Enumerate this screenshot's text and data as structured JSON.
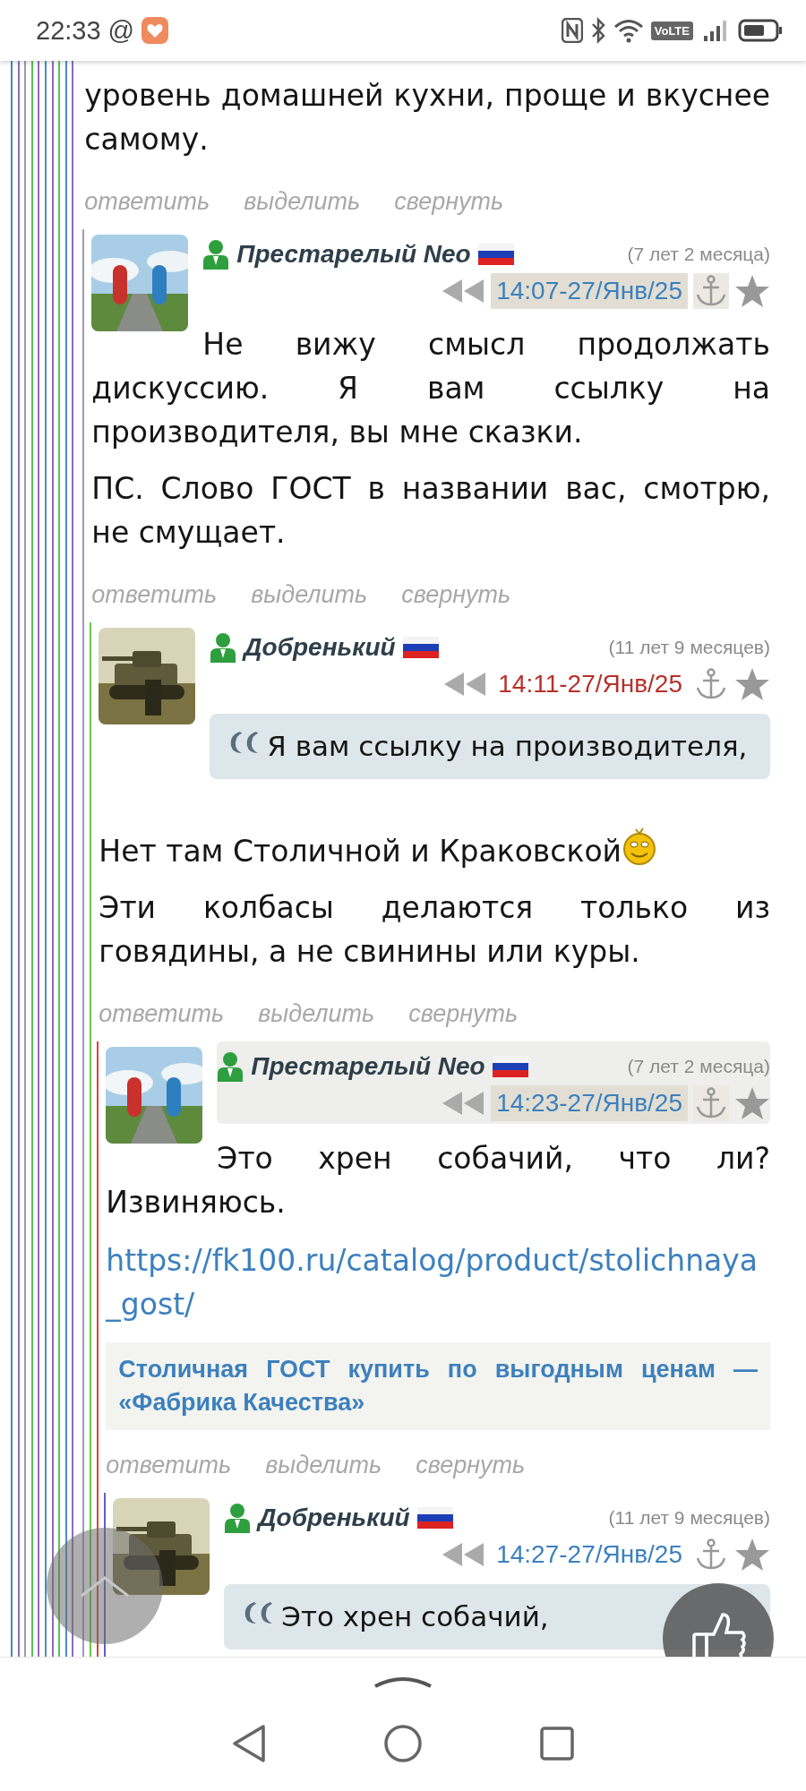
{
  "status_bar": {
    "time": "22:33",
    "at": "@",
    "volte": "VoLTE"
  },
  "thread_lines": [
    {
      "color": "#3a8fb7"
    },
    {
      "color": "#8e6fb5"
    },
    {
      "color": "#9a9aaa"
    },
    {
      "color": "#55c455"
    },
    {
      "color": "#8e6fb5"
    },
    {
      "color": "#4a8ec8"
    },
    {
      "color": "#8e6fb5"
    },
    {
      "color": "#55c455"
    },
    {
      "color": "#4a8ec8"
    }
  ],
  "comment": {
    "color": "#8e6fb5",
    "body": [
      {
        "kind": "paragraph",
        "text": "уровень домашней кухни, проще и вкуснее самому."
      }
    ],
    "actions": [
      "ответить",
      "выделить",
      "свернуть"
    ],
    "children": [
      {
        "color": "#a09ab8",
        "avatar": {
          "kind": "picture"
        },
        "author": "Престарелый Neo",
        "age": "(7 лет 2 месяца)",
        "time": "14:07-27/Янв/25",
        "time_shaded": true,
        "time_new": false,
        "header_highlighted": false,
        "body": [
          {
            "kind": "paragraph",
            "text": "Не вижу смысл продолжать дискуссию. Я вам ссылку на производителя, вы мне сказки."
          },
          {
            "kind": "paragraph",
            "text": "ПС. Слово ГОСТ в названии вас, смотрю, не смущает."
          }
        ],
        "actions": [
          "ответить",
          "выделить",
          "свернуть"
        ],
        "children": [
          {
            "color": "#66cc44",
            "avatar": {
              "kind": "picture"
            },
            "author": "Добренький",
            "age": "(11 лет 9 месяцев)",
            "time": "14:11-27/Янв/25",
            "time_shaded": false,
            "time_new": true,
            "header_highlighted": false,
            "body": [
              {
                "kind": "quote",
                "text": "Я вам ссылку на производителя,"
              },
              {
                "kind": "paragraph",
                "text": "Нет там Столичной и Краковской",
                "smiley": true
              },
              {
                "kind": "paragraph",
                "text": "Эти колбасы делаются только из говядины, а не свинины или куры."
              }
            ],
            "actions": [
              "ответить",
              "выделить",
              "свернуть"
            ],
            "children": [
              {
                "color": "#e04040",
                "avatar": {
                  "kind": "picture"
                },
                "author": "Престарелый Neo",
                "age": "(7 лет 2 месяца)",
                "time": "14:23-27/Янв/25",
                "time_shaded": true,
                "time_new": false,
                "header_highlighted": true,
                "body": [
                  {
                    "kind": "paragraph",
                    "text": "Это хрен собачий, что ли? Извиняюсь."
                  },
                  {
                    "kind": "link",
                    "text": "https://fk100.ru/catalog/product/stolichnaya_gost/"
                  },
                  {
                    "kind": "preview",
                    "text": "Столичная ГОСТ купить по выгодным ценам — «Фабрика Качества»"
                  }
                ],
                "actions": [
                  "ответить",
                  "выделить",
                  "свернуть"
                ],
                "children": [
                  {
                    "color": "#6060c0",
                    "avatar": {
                      "kind": "picture"
                    },
                    "author": "Добренький",
                    "age": "(11 лет 9 месяцев)",
                    "time": "14:27-27/Янв/25",
                    "time_shaded": false,
                    "time_new": false,
                    "header_highlighted": false,
                    "body": [
                      {
                        "kind": "quote",
                        "text": "Это хрен собачий,"
                      }
                    ]
                  }
                ]
              }
            ]
          }
        ]
      }
    ]
  }
}
